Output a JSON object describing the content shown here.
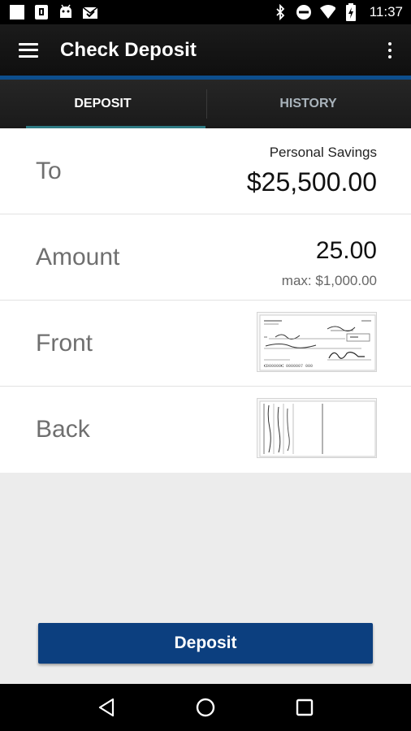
{
  "status_bar": {
    "time": "11:37",
    "left_icons": [
      "notification-square-icon",
      "sim-card-icon",
      "android-icon",
      "mail-check-icon"
    ],
    "right_icons": [
      "bluetooth-icon",
      "do-not-disturb-icon",
      "wifi-icon",
      "battery-charging-icon"
    ]
  },
  "app_bar": {
    "title": "Check Deposit"
  },
  "tabs": [
    {
      "label": "DEPOSIT",
      "active": true
    },
    {
      "label": "HISTORY",
      "active": false
    }
  ],
  "form": {
    "to": {
      "label": "To",
      "account_name": "Personal Savings",
      "balance": "$25,500.00"
    },
    "amount": {
      "label": "Amount",
      "value": "25.00",
      "max": "max: $1,000.00"
    },
    "front": {
      "label": "Front"
    },
    "back": {
      "label": "Back"
    }
  },
  "deposit_button": {
    "label": "Deposit"
  },
  "colors": {
    "accent_blue": "#0d4f8e",
    "button_blue": "#0c3f7f",
    "tab_indicator": "#2f7a83"
  },
  "nav_bar": {
    "icons": [
      "back-icon",
      "home-icon",
      "recents-icon"
    ]
  }
}
